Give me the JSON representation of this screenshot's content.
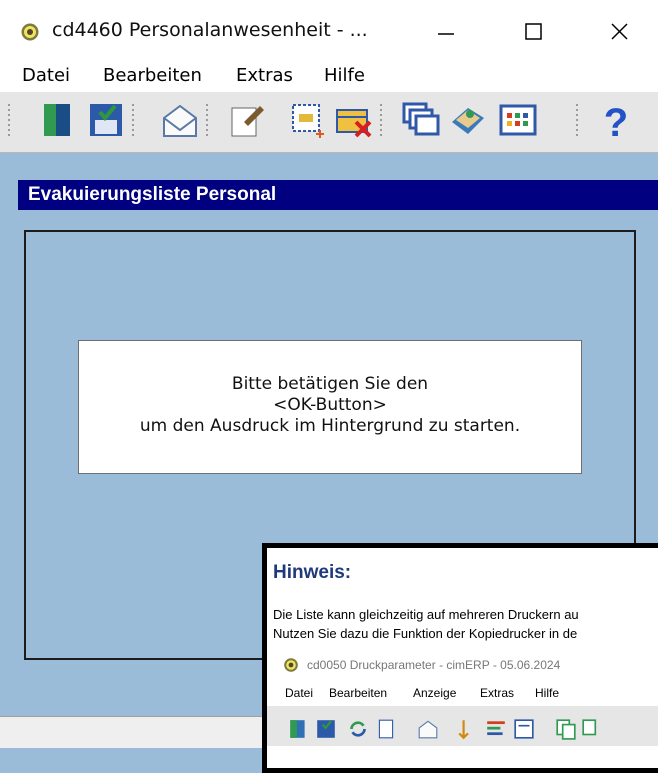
{
  "window": {
    "title": "cd4460 Personalanwesenheit - ...",
    "app_icon": "gear-icon"
  },
  "window_buttons": {
    "minimize": "minimize-icon",
    "maximize": "maximize-icon",
    "close": "close-icon"
  },
  "menu": {
    "items": [
      "Datei",
      "Bearbeiten",
      "Extras",
      "Hilfe"
    ]
  },
  "toolbar": {
    "buttons": [
      {
        "name": "exit-door-icon"
      },
      {
        "name": "save-icon"
      },
      {
        "name": "mail-icon"
      },
      {
        "name": "edit-icon"
      },
      {
        "name": "select-area-icon"
      },
      {
        "name": "delete-icon"
      },
      {
        "name": "windows-icon"
      },
      {
        "name": "book-icon"
      },
      {
        "name": "table-icon"
      },
      {
        "name": "help-icon"
      }
    ]
  },
  "section": {
    "title": "Evakuierungsliste Personal"
  },
  "message": {
    "line1": "Bitte betätigen Sie den",
    "line2": "<OK-Button>",
    "line3": "um den Ausdruck im Hintergrund zu starten."
  },
  "hint": {
    "title": "Hinweis:",
    "line1": "Die Liste kann gleichzeitig auf mehreren Druckern au",
    "line2": "Nutzen Sie dazu die Funktion der Kopiedrucker in de",
    "sub_window_title": "cd0050 Druckparameter - cimERP - 05.06.2024",
    "sub_menu": [
      "Datei",
      "Bearbeiten",
      "Anzeige",
      "Extras",
      "Hilfe"
    ]
  },
  "colors": {
    "background": "#9bbcd8",
    "header": "#000080",
    "hint_title": "#1f3a7a"
  }
}
